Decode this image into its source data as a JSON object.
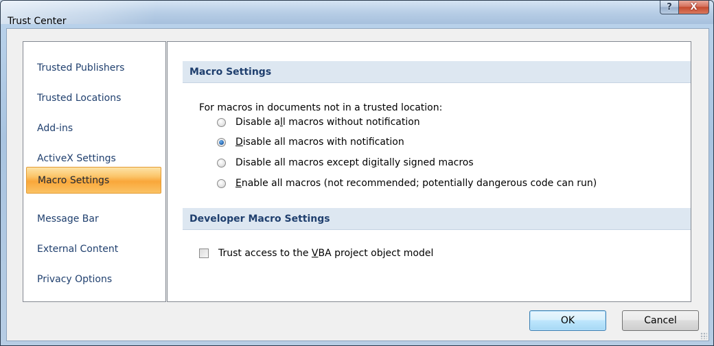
{
  "window": {
    "title": "Trust Center",
    "help_glyph": "?",
    "close_glyph": "X"
  },
  "sidebar": {
    "items": [
      {
        "label": "Trusted Publishers",
        "selected": false
      },
      {
        "label": "Trusted Locations",
        "selected": false
      },
      {
        "label": "Add-ins",
        "selected": false
      },
      {
        "label": "ActiveX Settings",
        "selected": false
      },
      {
        "label": "Macro Settings",
        "selected": true
      },
      {
        "label": "Message Bar",
        "selected": false
      },
      {
        "label": "External Content",
        "selected": false
      },
      {
        "label": "Privacy Options",
        "selected": false
      }
    ]
  },
  "macro_settings": {
    "header": "Macro Settings",
    "prompt": "For macros in documents not in a trusted location:",
    "options": [
      {
        "pre": "Disable a",
        "u": "l",
        "post": "l macros without notification",
        "checked": false
      },
      {
        "pre": "",
        "u": "D",
        "post": "isable all macros with notification",
        "checked": true
      },
      {
        "pre": "Disable all macros except di",
        "u": "g",
        "post": "itally signed macros",
        "checked": false
      },
      {
        "pre": "",
        "u": "E",
        "post": "nable all macros (not recommended; potentially dangerous code can run)",
        "checked": false
      }
    ]
  },
  "developer": {
    "header": "Developer Macro Settings",
    "checkbox": {
      "pre": "Trust access to the ",
      "u": "V",
      "post": "BA project object model",
      "checked": false
    }
  },
  "buttons": {
    "ok": "OK",
    "cancel": "Cancel"
  },
  "colors": {
    "selected_nav": "#f9a73a",
    "section_header_bg": "#dde7f1",
    "nav_text": "#1f3f6e"
  }
}
